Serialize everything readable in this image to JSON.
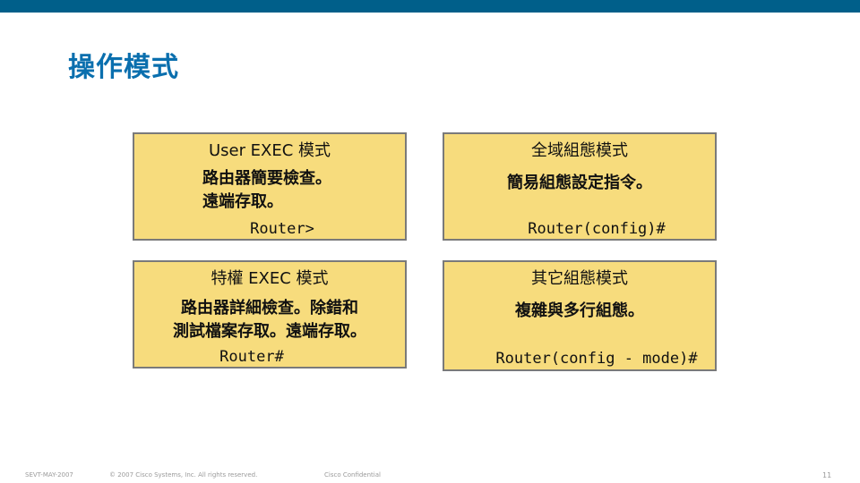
{
  "slide": {
    "title": "操作模式"
  },
  "boxes": {
    "user_exec": {
      "title": "User EXEC 模式",
      "lines": [
        "路由器簡要檢查。",
        "遠端存取。"
      ],
      "prompt": "Router>"
    },
    "global_config": {
      "title": "全域組態模式",
      "lines": [
        "簡易組態設定指令。"
      ],
      "prompt": "Router(config)#"
    },
    "privileged_exec": {
      "title": "特權 EXEC 模式",
      "lines": [
        "路由器詳細檢查。除錯和",
        "測試檔案存取。遠端存取。"
      ],
      "prompt": "Router#"
    },
    "other_config": {
      "title": "其它組態模式",
      "lines": [
        "複雜與多行組態。"
      ],
      "prompt": "Router(config - mode)#"
    }
  },
  "footer": {
    "date": "SEVT-MAY-2007",
    "copyright": "© 2007 Cisco Systems, Inc. All rights reserved.",
    "confidential": "Cisco Confidential",
    "page": "11"
  },
  "colors": {
    "top_bar": "#005f8a",
    "title": "#0a6fae",
    "box_fill": "#f7dc7d",
    "box_border": "#7a7a7a"
  }
}
